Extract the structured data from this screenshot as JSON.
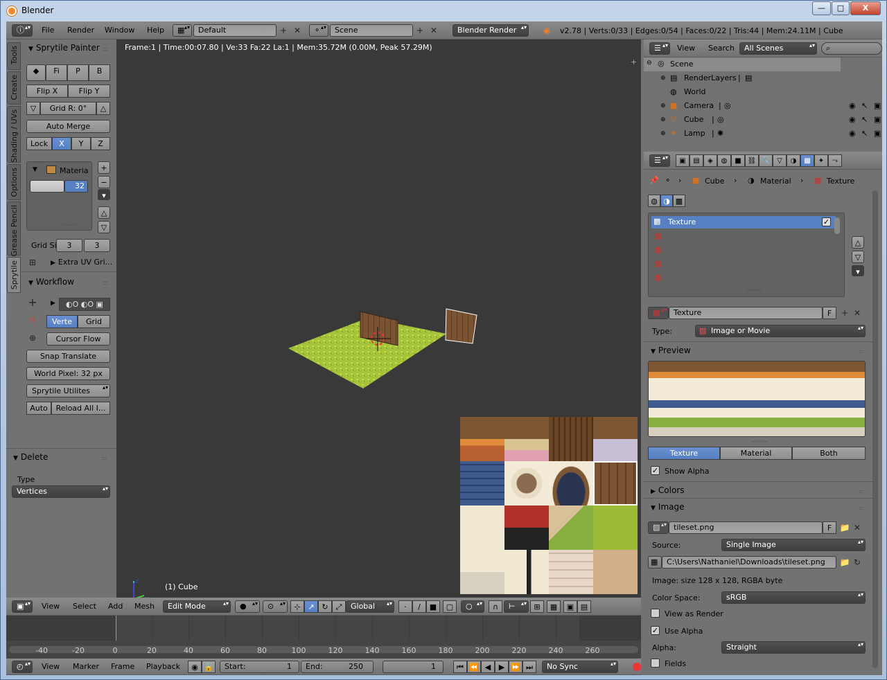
{
  "window": {
    "title": "Blender",
    "minimize": "—",
    "maximize": "□",
    "close": "X"
  },
  "info_header": {
    "menus": [
      "File",
      "Render",
      "Window",
      "Help"
    ],
    "layout": "Default",
    "scene": "Scene",
    "engine": "Blender Render",
    "stats": "v2.78 | Verts:0/33 | Edges:0/54 | Faces:0/22 | Tris:44 | Mem:24.11M | Cube"
  },
  "tool_tabs": [
    "Tools",
    "Create",
    "Shading / UVs",
    "Options",
    "Grease Pencil",
    "Sprytile"
  ],
  "sprytile": {
    "title": "Sprytile Painter",
    "mode_buttons": [
      "Fi",
      "P",
      "B"
    ],
    "flip_x": "Flip X",
    "flip_y": "Flip Y",
    "grid_rotation": "Grid R: 0°",
    "auto_merge": "Auto Merge",
    "lock": "Lock",
    "axes": [
      "X",
      "Y",
      "Z"
    ],
    "material_label": "Materia",
    "material_value": "32",
    "grid_size_label": "Grid Si",
    "grid_x": "3",
    "grid_y": "3",
    "extra_uv": "Extra UV Gri..."
  },
  "workflow": {
    "title": "Workflow",
    "vert": "Verte",
    "grid": "Grid",
    "cursor_flow": "Cursor Flow",
    "snap_translate": "Snap Translate",
    "world_pixel": "World Pixel: 32 px",
    "utilities": "Sprytile Utilites",
    "auto": "Auto",
    "reload": "Reload All I..."
  },
  "delete_panel": {
    "title": "Delete",
    "type_label": "Type",
    "type_value": "Vertices"
  },
  "viewport": {
    "info": "Frame:1 | Time:00:07.80 | Ve:33 Fa:22 La:1 | Mem:35.72M (0.00M, Peak 57.29M)",
    "object_label": "(1) Cube"
  },
  "viewport_header": {
    "menus": [
      "View",
      "Select",
      "Add",
      "Mesh"
    ],
    "mode": "Edit Mode",
    "orientation": "Global"
  },
  "timeline": {
    "ticks": [
      "-40",
      "-20",
      "0",
      "20",
      "40",
      "60",
      "80",
      "100",
      "120",
      "140",
      "160",
      "180",
      "200",
      "220",
      "240",
      "260"
    ],
    "menus": [
      "View",
      "Marker",
      "Frame",
      "Playback"
    ],
    "start_label": "Start:",
    "start": "1",
    "end_label": "End:",
    "end": "250",
    "current": "1",
    "sync": "No Sync"
  },
  "outliner": {
    "menus": [
      "View",
      "Search"
    ],
    "filter": "All Scenes",
    "items": [
      {
        "label": "Scene",
        "level": 0
      },
      {
        "label": "RenderLayers",
        "level": 1
      },
      {
        "label": "World",
        "level": 1
      },
      {
        "label": "Camera",
        "level": 1
      },
      {
        "label": "Cube",
        "level": 1
      },
      {
        "label": "Lamp",
        "level": 1
      }
    ]
  },
  "properties": {
    "breadcrumb": [
      "Cube",
      "Material",
      "Texture"
    ],
    "texture_slot": "Texture",
    "texture_name": "Texture",
    "fake_user": "F",
    "type_label": "Type:",
    "type_value": "Image or Movie",
    "preview_title": "Preview",
    "preview_tabs": [
      "Texture",
      "Material",
      "Both"
    ],
    "show_alpha": "Show Alpha",
    "colors_title": "Colors",
    "image_title": "Image",
    "image_name": "tileset.png",
    "source_label": "Source:",
    "source_value": "Single Image",
    "path": "C:\\Users\\Nathaniel\\Downloads\\tileset.png",
    "image_info": "Image: size 128 x 128, RGBA byte",
    "colorspace_label": "Color Space:",
    "colorspace_value": "sRGB",
    "view_as_render": "View as Render",
    "use_alpha": "Use Alpha",
    "alpha_label": "Alpha:",
    "alpha_value": "Straight",
    "fields": "Fields"
  },
  "colors": {
    "accent": "#5680c2",
    "viewport": "#393939",
    "panel": "#727272",
    "grass": "#a6c43a",
    "wood": "#7a5332"
  }
}
